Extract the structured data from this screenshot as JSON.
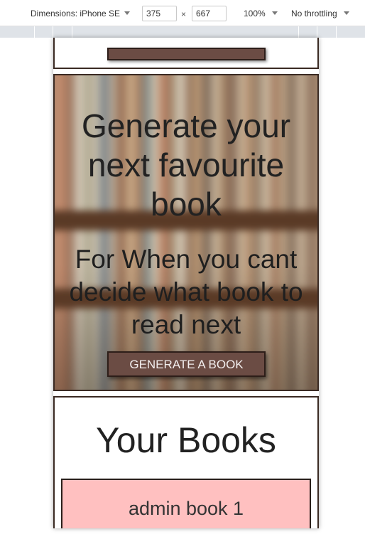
{
  "devtools": {
    "dimensions_label": "Dimensions: iPhone SE",
    "width_value": "375",
    "times": "×",
    "height_value": "667",
    "zoom": "100%",
    "throttling": "No throttling"
  },
  "hero": {
    "title": "Generate your next favourite book",
    "subtitle": "For When you cant decide what book to read next",
    "button_label": "GENERATE A BOOK"
  },
  "books": {
    "title": "Your Books",
    "items": [
      {
        "label": "admin book 1"
      }
    ]
  },
  "colors": {
    "button_bg": "#6b4c44",
    "border": "#3a2a23",
    "book_item_bg": "#ffc0c0"
  }
}
